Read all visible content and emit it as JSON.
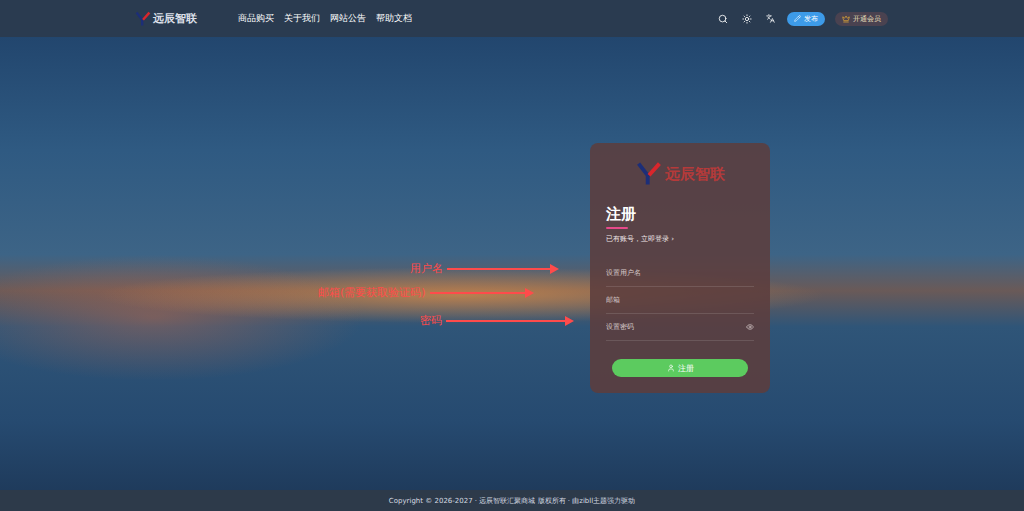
{
  "header": {
    "logo": "远辰智联",
    "nav": [
      "商品购买",
      "关于我们",
      "网站公告",
      "帮助文档"
    ],
    "publish": "发布",
    "vip": "开通会员"
  },
  "card": {
    "logo": "远辰智联",
    "title": "注册",
    "login_prompt": "已有账号，立即登录",
    "login_arrow": "›",
    "fields": [
      {
        "placeholder": "设置用户名",
        "kind": "text"
      },
      {
        "placeholder": "邮箱",
        "kind": "text"
      },
      {
        "placeholder": "设置密码",
        "kind": "password"
      }
    ],
    "submit": "注册"
  },
  "annotations": [
    {
      "label": "用户名"
    },
    {
      "label": "邮箱(需要获取验证码)"
    },
    {
      "label": "密码"
    }
  ],
  "footer": "Copyright © 2026-2027 · 远辰智联汇聚商城 版权所有 · 由zibll主题强力驱动"
}
